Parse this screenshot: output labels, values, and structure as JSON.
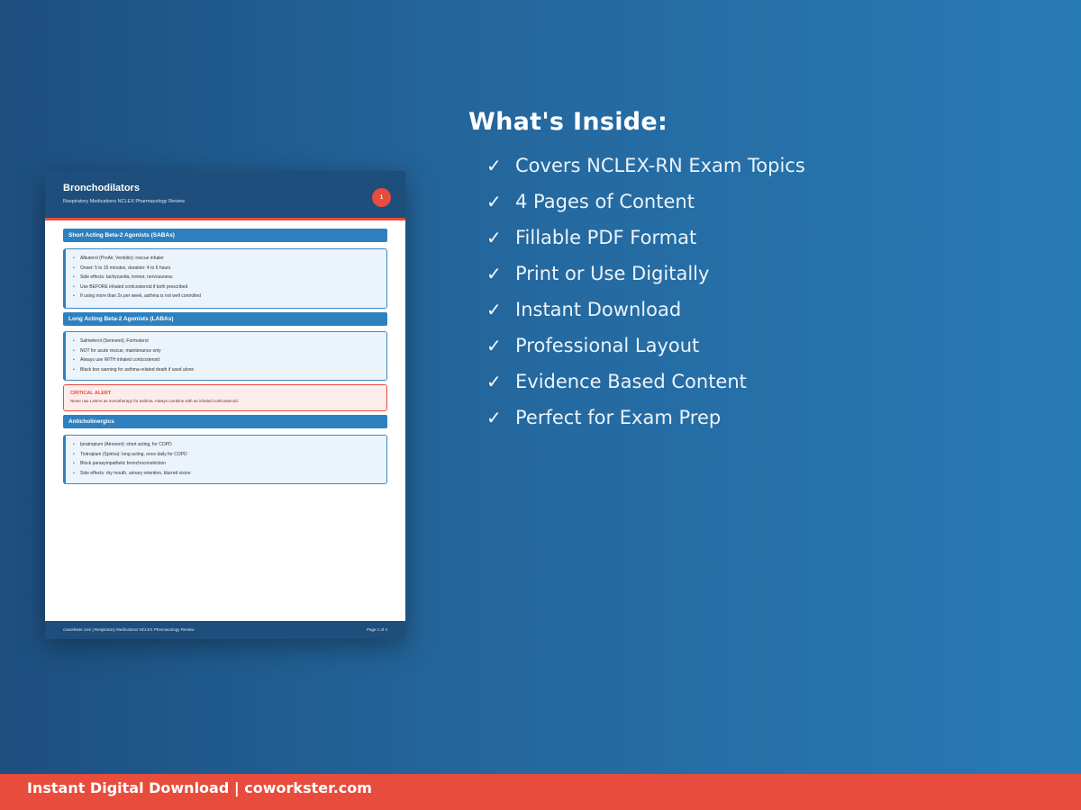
{
  "document": {
    "title": "Bronchodilators",
    "subtitle": "Respiratory Medications NCLEX Pharmacology Review",
    "page_badge": "1",
    "sections": [
      {
        "heading": "Short Acting Beta-2 Agonists (SABAs)",
        "items": [
          "Albuterol (ProAir, Ventolin): rescue inhaler",
          "Onset: 5 to 15 minutes, duration: 4 to 6 hours",
          "Side effects: tachycardia, tremor, nervousness",
          "Use BEFORE inhaled corticosteroid if both prescribed",
          "If using more than 2x per week, asthma is not well controlled"
        ]
      },
      {
        "heading": "Long Acting Beta-2 Agonists (LABAs)",
        "items": [
          "Salmeterol (Serevent), Formoterol",
          "NOT for acute rescue, maintenance only",
          "Always use WITH inhaled corticosteroid",
          "Black box warning for asthma-related death if used alone"
        ]
      },
      {
        "heading": "Anticholinergics",
        "items": [
          "Ipratropium (Atrovent): short acting, for COPD",
          "Tiotropium (Spiriva): long acting, once daily for COPD",
          "Block parasympathetic bronchoconstriction",
          "Side effects: dry mouth, urinary retention, blurred vision"
        ]
      }
    ],
    "alert": {
      "title": "CRITICAL ALERT",
      "text": "Never use LABAs as monotherapy for asthma. Always combine with an inhaled corticosteroid."
    },
    "footer_left": "coworkster.com | Respiratory Medications NCLEX Pharmacology Review",
    "footer_right": "Page 1 of 4"
  },
  "features": {
    "title": "What's Inside:",
    "check_symbol": "✓",
    "items": [
      "Covers NCLEX-RN Exam Topics",
      "4 Pages of Content",
      "Fillable PDF Format",
      "Print or Use Digitally",
      "Instant Download",
      "Professional Layout",
      "Evidence Based Content",
      "Perfect for Exam Prep"
    ]
  },
  "bottom_bar": {
    "text": "Instant Digital Download | coworkster.com"
  },
  "colors": {
    "accent_red": "#e74c3c",
    "header_navy": "#1e4e7b",
    "section_blue": "#2e80bf"
  }
}
